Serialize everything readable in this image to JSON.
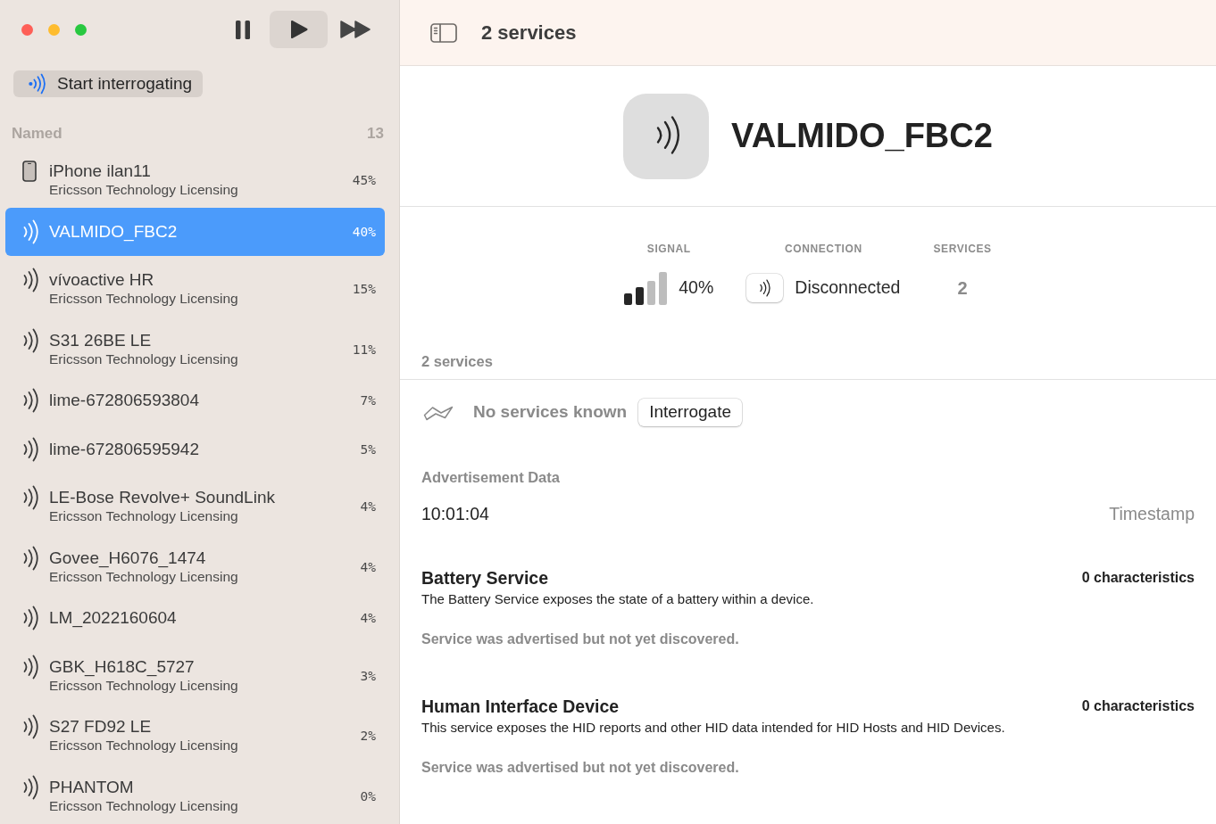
{
  "toolbar": {
    "buttons": [
      {
        "kind": "pause",
        "selected": false
      },
      {
        "kind": "play",
        "selected": true
      },
      {
        "kind": "fast_forward",
        "selected": false
      }
    ]
  },
  "sidebar": {
    "scan_button": {
      "label": "Start interrogating"
    },
    "section": {
      "title": "Named",
      "count": "13"
    },
    "devices": [
      {
        "kind": "phone",
        "name": "iPhone ilan11",
        "subtitle": "Ericsson Technology Licensing",
        "signal": "45%",
        "selected": false
      },
      {
        "kind": "beacon",
        "name": "VALMIDO_FBC2",
        "signal": "40%",
        "selected": true
      },
      {
        "kind": "beacon",
        "name": "vívoactive HR",
        "subtitle": "Ericsson Technology Licensing",
        "signal": "15%",
        "selected": false
      },
      {
        "kind": "beacon",
        "name": "S31 26BE LE",
        "subtitle": "Ericsson Technology Licensing",
        "signal": "11%",
        "selected": false
      },
      {
        "kind": "beacon",
        "name": "lime-672806593804",
        "signal": "7%",
        "selected": false
      },
      {
        "kind": "beacon",
        "name": "lime-672806595942",
        "signal": "5%",
        "selected": false
      },
      {
        "kind": "beacon",
        "name": "LE-Bose Revolve+ SoundLink",
        "subtitle": "Ericsson Technology Licensing",
        "signal": "4%",
        "selected": false
      },
      {
        "kind": "beacon",
        "name": "Govee_H6076_1474",
        "subtitle": "Ericsson Technology Licensing",
        "signal": "4%",
        "selected": false
      },
      {
        "kind": "beacon",
        "name": "LM_2022160604",
        "signal": "4%",
        "selected": false
      },
      {
        "kind": "beacon",
        "name": "GBK_H618C_5727",
        "subtitle": "Ericsson Technology Licensing",
        "signal": "3%",
        "selected": false
      },
      {
        "kind": "beacon",
        "name": "S27 FD92 LE",
        "subtitle": "Ericsson Technology Licensing",
        "signal": "2%",
        "selected": false
      },
      {
        "kind": "beacon",
        "name": "PHANTOM",
        "subtitle": "Ericsson Technology Licensing",
        "signal": "0%",
        "selected": false
      }
    ]
  },
  "detail": {
    "title": "2 services",
    "device": {
      "name": "VALMIDO_FBC2"
    },
    "stats": [
      {
        "kind": "signal",
        "label": "SIGNAL",
        "value": "40%"
      },
      {
        "kind": "connection",
        "label": "CONNECTION",
        "value": "Disconnected"
      },
      {
        "kind": "count",
        "label": "SERVICES",
        "value": "2"
      }
    ],
    "services_heading": "2 services",
    "empty_state": {
      "text": "No services known",
      "button": "Interrogate"
    },
    "advertisement": {
      "heading": "Advertisement Data",
      "rows": [
        {
          "value": "10:01:04",
          "label": "Timestamp"
        }
      ]
    },
    "services": [
      {
        "name": "Battery Service",
        "characteristics": "0 characteristics",
        "description": "The Battery Service exposes the state of a battery within a device.",
        "status": "Service was advertised but not yet discovered."
      },
      {
        "name": "Human Interface Device",
        "characteristics": "0 characteristics",
        "description": "This service exposes the HID reports and other HID data intended for HID Hosts and HID Devices.",
        "status": "Service was advertised but not yet discovered."
      }
    ]
  }
}
